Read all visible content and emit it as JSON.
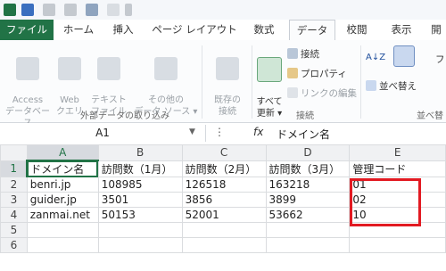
{
  "tabs": [
    "ファイル",
    "ホーム",
    "挿入",
    "ページ レイアウト",
    "数式",
    "データ",
    "校閲",
    "表示",
    "開"
  ],
  "ribbon": {
    "access": "Access\nデータベース",
    "web": "Web\nクエリ",
    "text": "テキスト\nファイル",
    "other": "その他の\nデータ ソース ▾",
    "existing": "既存の\n接続",
    "ext_group": "外部データの取り込み",
    "refresh": "すべて\n更新 ▾",
    "connections": "接続",
    "properties": "プロパティ",
    "editlinks": "リンクの編集",
    "conn_group": "接続",
    "sort_az": "A↓Z",
    "sort_label": "並べ替え",
    "sort_group": "並べ替",
    "filter_partial": "フ"
  },
  "formula_bar": {
    "name": "A1",
    "fx": "fx",
    "value": "ドメイン名"
  },
  "columns": [
    "A",
    "B",
    "C",
    "D",
    "E"
  ],
  "rows": [
    {
      "n": "1",
      "cells": [
        "ドメイン名",
        "訪問数（1月）",
        "訪問数（2月）",
        "訪問数（3月）",
        "管理コード"
      ]
    },
    {
      "n": "2",
      "cells": [
        "benri.jp",
        "108985",
        "126518",
        "163218",
        "01"
      ]
    },
    {
      "n": "3",
      "cells": [
        "guider.jp",
        "3501",
        "3856",
        "3899",
        "02"
      ]
    },
    {
      "n": "4",
      "cells": [
        "zanmai.net",
        "50153",
        "52001",
        "53662",
        "10"
      ]
    },
    {
      "n": "5",
      "cells": [
        "",
        "",
        "",
        "",
        ""
      ]
    },
    {
      "n": "6",
      "cells": [
        "",
        "",
        "",
        "",
        ""
      ]
    }
  ],
  "colors": {
    "excel_green": "#217346",
    "highlight_red": "#e21a22"
  }
}
